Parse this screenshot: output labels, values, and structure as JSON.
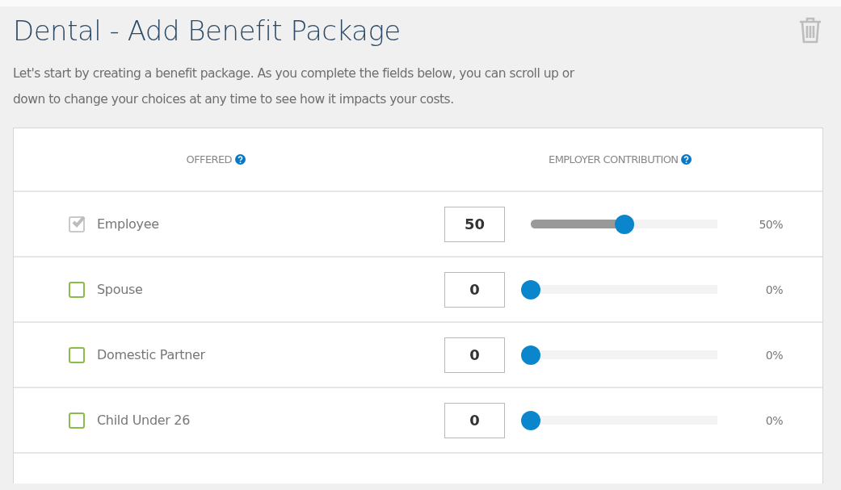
{
  "title": "Dental - Add Benefit Package",
  "description": "Let's start by creating a benefit package. As you complete the fields below, you can scroll up or down to change your choices at any time to see how it impacts your costs.",
  "table": {
    "columns": [
      "OFFERED",
      "EMPLOYER CONTRIBUTION"
    ],
    "rows": [
      {
        "label": "Employee",
        "checked": true,
        "value": "50",
        "level": 0.5,
        "reading": "50%"
      },
      {
        "label": "Spouse",
        "checked": false,
        "value": "0",
        "level": 0,
        "reading": "0%"
      },
      {
        "label": "Domestic Partner",
        "checked": false,
        "value": "0",
        "level": 0,
        "reading": "0%"
      },
      {
        "label": "Child Under 26",
        "checked": false,
        "value": "0",
        "level": 0,
        "reading": "0%"
      }
    ]
  }
}
